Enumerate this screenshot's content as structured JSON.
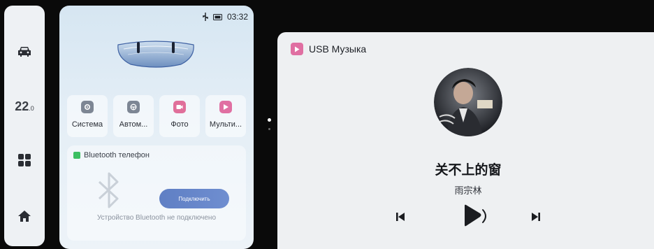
{
  "statusbar": {
    "time": "03:32",
    "usb_icon": "usb-icon",
    "battery_icon": "battery-icon"
  },
  "rail": {
    "temperature": "22",
    "temperature_decimal": ".0",
    "items": [
      {
        "icon": "car-icon"
      },
      {
        "icon": "apps-grid-icon"
      },
      {
        "icon": "home-icon"
      }
    ]
  },
  "apps": [
    {
      "label": "Система",
      "icon": "settings-icon",
      "color": "#7d8694"
    },
    {
      "label": "Автом...",
      "icon": "steering-wheel-icon",
      "color": "#7d8694"
    },
    {
      "label": "Фото",
      "icon": "camera-icon",
      "color": "#e06f9a"
    },
    {
      "label": "Мульти...",
      "icon": "play-icon",
      "color": "#e06fa2"
    }
  ],
  "bluetooth": {
    "title": "Bluetooth телефон",
    "connect_label": "Подключить",
    "status": "Устройство Bluetooth не подключено"
  },
  "music": {
    "source": "USB Музыка",
    "title": "关不上的窗",
    "artist": "雨宗林",
    "accent": "#e06fa2"
  }
}
